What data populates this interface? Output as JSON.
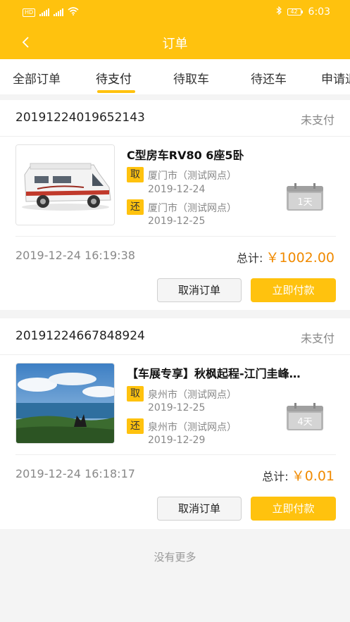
{
  "status_bar": {
    "time": "6:03",
    "battery": "42",
    "hd": "HD",
    "net1": "4G",
    "net2": "4G"
  },
  "nav": {
    "title": "订单"
  },
  "tabs": [
    {
      "label": "全部订单",
      "active": false
    },
    {
      "label": "待支付",
      "active": true
    },
    {
      "label": "待取车",
      "active": false
    },
    {
      "label": "待还车",
      "active": false
    },
    {
      "label": "申请退",
      "active": false
    }
  ],
  "orders": [
    {
      "order_no": "20191224019652143",
      "status": "未支付",
      "product_name": "C型房车RV80 6座5卧",
      "pickup_tag": "取",
      "pickup_location": "厦门市（测试网点）",
      "pickup_date": "2019-12-24",
      "return_tag": "还",
      "return_location": "厦门市（测试网点）",
      "return_date": "2019-12-25",
      "days": "1天",
      "created_at": "2019-12-24 16:19:38",
      "total_label": "总计:",
      "total_price": "￥1002.00",
      "cancel_label": "取消订单",
      "pay_label": "立即付款"
    },
    {
      "order_no": "20191224667848924",
      "status": "未支付",
      "product_name": "【车展专享】秋枫起程-江门圭峰…",
      "pickup_tag": "取",
      "pickup_location": "泉州市（测试网点）",
      "pickup_date": "2019-12-25",
      "return_tag": "还",
      "return_location": "泉州市（测试网点）",
      "return_date": "2019-12-29",
      "days": "4天",
      "created_at": "2019-12-24 16:18:17",
      "total_label": "总计:",
      "total_price": "￥0.01",
      "cancel_label": "取消订单",
      "pay_label": "立即付款"
    }
  ],
  "footer": {
    "no_more": "没有更多"
  },
  "colors": {
    "accent": "#ffc20e",
    "price": "#f08a00",
    "muted": "#888888"
  }
}
